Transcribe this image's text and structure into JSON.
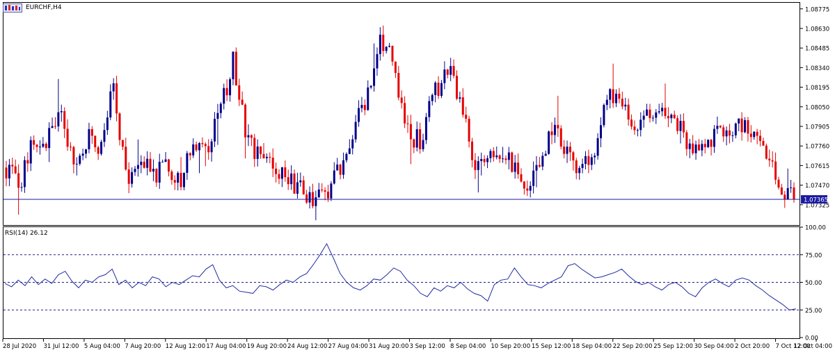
{
  "window": {
    "title": "EURCHF,H4",
    "icon": "chart-window-icon"
  },
  "colors": {
    "bull": "#00008b",
    "bear": "#e60000",
    "rsi_line": "#1f2aa0",
    "price_line": "#1a1aa0",
    "frame": "#000000",
    "background": "#ffffff",
    "label_bg": "#1a1aa0"
  },
  "chart_data": [
    {
      "type": "candlestick",
      "symbol": "EURCHF",
      "timeframe": "H4",
      "title": "EURCHF,H4",
      "ylim": [
        1.0718,
        1.0882
      ],
      "y_ticks": [
        "1.08775",
        "1.08630",
        "1.08485",
        "1.08340",
        "1.08195",
        "1.08050",
        "1.07905",
        "1.07760",
        "1.07615",
        "1.07470",
        "1.07325"
      ],
      "current_price": "1.07365",
      "approx_close_path": [
        [
          "28 Jul 2020",
          1.076
        ],
        [
          "29 Jul 2020",
          1.0745
        ],
        [
          "30 Jul 2020",
          1.0782
        ],
        [
          "31 Jul 12:00",
          1.0775
        ],
        [
          "3 Aug",
          1.0805
        ],
        [
          "4 Aug",
          1.076
        ],
        [
          "5 Aug 04:00",
          1.0782
        ],
        [
          "6 Aug",
          1.0775
        ],
        [
          "6 Aug 12:00",
          1.0818
        ],
        [
          "7 Aug 20:00",
          1.0752
        ],
        [
          "10 Aug",
          1.0768
        ],
        [
          "11 Aug",
          1.0755
        ],
        [
          "12 Aug 12:00",
          1.0762
        ],
        [
          "13 Aug",
          1.075
        ],
        [
          "14 Aug",
          1.0782
        ],
        [
          "17 Aug 04:00",
          1.077
        ],
        [
          "18 Aug",
          1.08
        ],
        [
          "19 Aug 04:00",
          1.084
        ],
        [
          "19 Aug 20:00",
          1.0785
        ],
        [
          "20 Aug",
          1.0765
        ],
        [
          "21 Aug",
          1.0758
        ],
        [
          "24 Aug 12:00",
          1.0752
        ],
        [
          "25 Aug",
          1.0745
        ],
        [
          "26 Aug",
          1.0738
        ],
        [
          "27 Aug 04:00",
          1.0742
        ],
        [
          "28 Aug",
          1.076
        ],
        [
          "28 Aug 12:00",
          1.079
        ],
        [
          "31 Aug",
          1.081
        ],
        [
          "31 Aug 20:00",
          1.086
        ],
        [
          "1 Sep",
          1.0835
        ],
        [
          "2 Sep",
          1.0785
        ],
        [
          "3 Sep 12:00",
          1.078
        ],
        [
          "4 Sep",
          1.0812
        ],
        [
          "7 Sep",
          1.0835
        ],
        [
          "8 Sep 04:00",
          1.081
        ],
        [
          "9 Sep",
          1.0765
        ],
        [
          "10 Sep 20:00",
          1.0765
        ],
        [
          "11 Sep",
          1.0772
        ],
        [
          "14 Sep",
          1.076
        ],
        [
          "15 Sep 12:00",
          1.0742
        ],
        [
          "16 Sep",
          1.0765
        ],
        [
          "17 Sep",
          1.0795
        ],
        [
          "18 Sep 04:00",
          1.077
        ],
        [
          "21 Sep",
          1.0755
        ],
        [
          "22 Sep 20:00",
          1.077
        ],
        [
          "23 Sep",
          1.0815
        ],
        [
          "24 Sep",
          1.0805
        ],
        [
          "25 Sep 12:00",
          1.0792
        ],
        [
          "28 Sep",
          1.08
        ],
        [
          "29 Sep",
          1.081
        ],
        [
          "30 Sep 04:00",
          1.0795
        ],
        [
          "1 Oct",
          1.078
        ],
        [
          "2 Oct 20:00",
          1.0768
        ],
        [
          "5 Oct",
          1.0785
        ],
        [
          "6 Oct",
          1.0782
        ],
        [
          "7 Oct 12:00",
          1.079
        ],
        [
          "8 Oct",
          1.0785
        ],
        [
          "9 Oct",
          1.0765
        ],
        [
          "12 Oct",
          1.0745
        ],
        [
          "12 Oct 04:00",
          1.0736
        ]
      ]
    },
    {
      "type": "line",
      "indicator": "RSI",
      "label": "RSI(14) 26.12",
      "ylim": [
        0,
        100
      ],
      "y_ticks": [
        "100.00",
        "75.00",
        "50.00",
        "25.00",
        "0.00"
      ],
      "levels": [
        75,
        50,
        25
      ],
      "values": [
        49,
        46,
        52,
        47,
        55,
        48,
        53,
        49,
        57,
        60,
        51,
        45,
        52,
        50,
        55,
        57,
        62,
        48,
        52,
        45,
        50,
        47,
        55,
        53,
        46,
        50,
        48,
        52,
        56,
        55,
        62,
        66,
        52,
        45,
        47,
        42,
        41,
        40,
        47,
        46,
        43,
        48,
        52,
        50,
        55,
        58,
        66,
        75,
        85,
        72,
        58,
        50,
        45,
        43,
        47,
        53,
        52,
        57,
        63,
        60,
        52,
        47,
        40,
        37,
        45,
        42,
        47,
        45,
        50,
        44,
        40,
        38,
        33,
        48,
        52,
        53,
        63,
        55,
        48,
        47,
        45,
        49,
        52,
        55,
        65,
        67,
        62,
        58,
        54,
        55,
        57,
        59,
        62,
        56,
        51,
        48,
        50,
        46,
        43,
        48,
        50,
        46,
        40,
        37,
        45,
        50,
        53,
        49,
        46,
        52,
        54,
        52,
        47,
        43,
        38,
        34,
        30,
        25,
        26
      ]
    }
  ],
  "x_axis": {
    "labels": [
      "28 Jul 2020",
      "31 Jul 12:00",
      "5 Aug 04:00",
      "7 Aug 20:00",
      "12 Aug 12:00",
      "17 Aug 04:00",
      "19 Aug 20:00",
      "24 Aug 12:00",
      "27 Aug 04:00",
      "31 Aug 20:00",
      "3 Sep 12:00",
      "8 Sep 04:00",
      "10 Sep 20:00",
      "15 Sep 12:00",
      "18 Sep 04:00",
      "22 Sep 20:00",
      "25 Sep 12:00",
      "30 Sep 04:00",
      "2 Oct 20:00",
      "7 Oct 12:00",
      "12 Oct 04:00"
    ]
  }
}
